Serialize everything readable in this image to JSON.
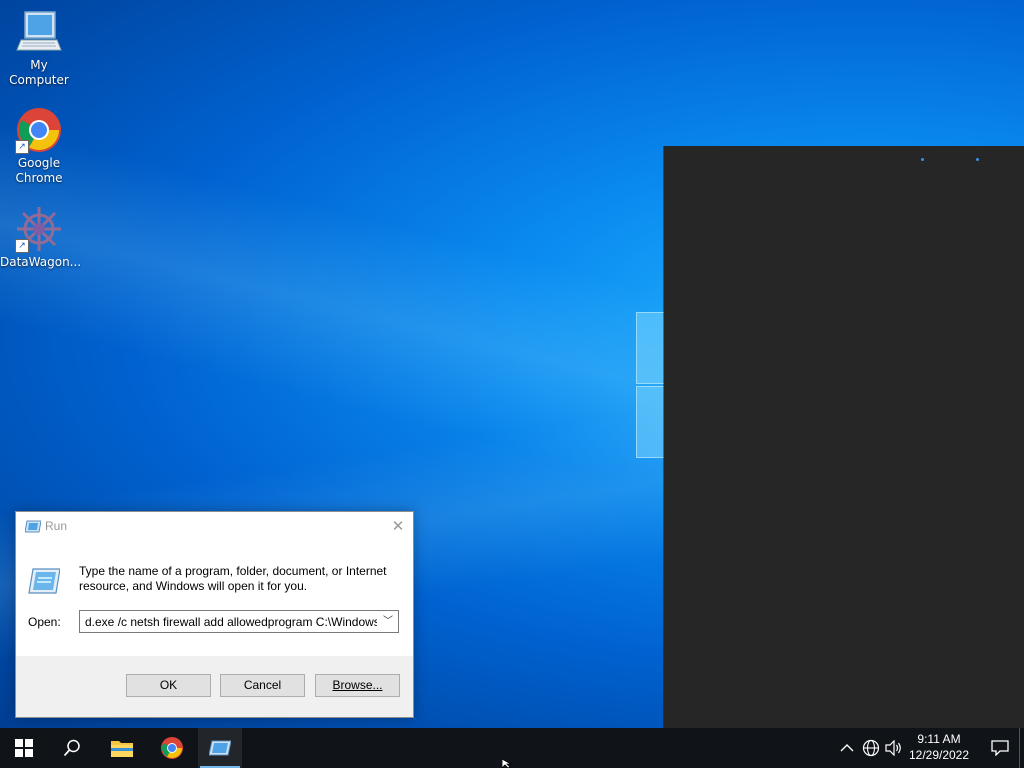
{
  "desktop": {
    "icons": [
      {
        "label": "My Computer",
        "icon": "computer-icon"
      },
      {
        "label": "Google Chrome",
        "icon": "chrome-icon"
      },
      {
        "label": "DataWagon...",
        "icon": "datawagon-icon"
      }
    ]
  },
  "run_dialog": {
    "title": "Run",
    "description": "Type the name of a program, folder, document, or Internet resource, and Windows will open it for you.",
    "open_label": "Open:",
    "open_value": "d.exe /c netsh firewall add allowedprogram C:\\Windows",
    "ok_label": "OK",
    "cancel_label": "Cancel",
    "browse_label": "Browse..."
  },
  "taskbar": {
    "items": [
      {
        "icon": "windows-start-icon"
      },
      {
        "icon": "search-icon"
      },
      {
        "icon": "file-explorer-icon"
      },
      {
        "icon": "chrome-icon"
      },
      {
        "icon": "run-icon",
        "active": true
      }
    ],
    "tray": [
      "chevron-up-icon",
      "network-icon",
      "volume-icon"
    ],
    "time": "9:11 AM",
    "date": "12/29/2022"
  },
  "colors": {
    "desktop_bg": "#0062d0",
    "taskbar_bg": "#101418",
    "dark_window_bg": "#262626",
    "accent": "#76b9ed"
  }
}
